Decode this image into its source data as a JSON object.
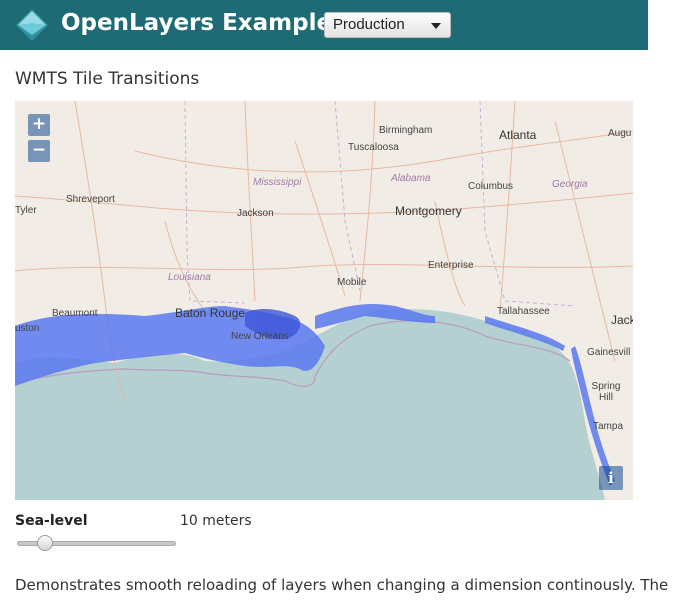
{
  "header": {
    "brand": "OpenLayers Examples",
    "version_select": {
      "selected": "Production"
    },
    "colors": {
      "navbar": "#1f6b75",
      "logo": "#4fb3c7"
    }
  },
  "page": {
    "title": "WMTS Tile Transitions",
    "description": "Demonstrates smooth reloading of layers when changing a dimension continously. The"
  },
  "map": {
    "zoom_in": "+",
    "zoom_out": "−",
    "attribution": "i",
    "labels": {
      "birmingham": "Birmingham",
      "atlanta": "Atlanta",
      "augusta": "Augu",
      "tuscaloosa": "Tuscaloosa",
      "mississippi": "Mississippi",
      "alabama": "Alabama",
      "columbus": "Columbus",
      "georgia": "Georgia",
      "tyler": "Tyler",
      "shreveport": "Shreveport",
      "jackson": "Jackson",
      "montgomery": "Montgomery",
      "enterprise": "Enterprise",
      "louisiana": "Louisiana",
      "mobile": "Mobile",
      "tallahassee": "Tallahassee",
      "jacksonville": "Jack",
      "houston": "uston",
      "beaumont": "Beaumont",
      "baton_rouge": "Baton Rouge",
      "new_orleans": "New Orleans",
      "gainesville": "Gainesvill",
      "spring_hill": "Spring Hill",
      "tampa": "Tampa"
    },
    "colors": {
      "land": "#f1ede6",
      "water": "#b5d0d0",
      "flood": "#5a78f0",
      "roads": "#e8b8a0",
      "border": "#b89cc0"
    }
  },
  "control": {
    "label": "Sea-level",
    "value_text": "10 meters",
    "slider_fraction": 0.14
  }
}
